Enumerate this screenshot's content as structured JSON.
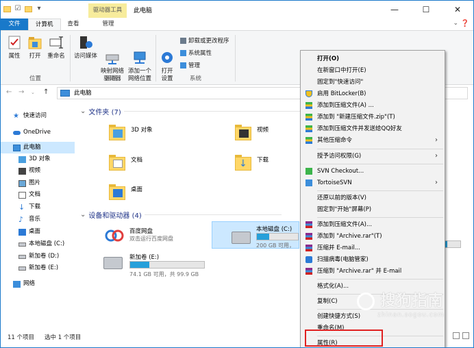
{
  "titlebar": {
    "context_band": "驱动器工具",
    "title": "此电脑",
    "minimize": "—",
    "maximize": "☐",
    "close": "✕"
  },
  "tabs": [
    {
      "label": "文件"
    },
    {
      "label": "计算机"
    },
    {
      "label": "查看"
    },
    {
      "label": "管理"
    }
  ],
  "ribbon": {
    "location": {
      "label": "位置",
      "buttons": [
        "属性",
        "打开",
        "重命名"
      ]
    },
    "network": {
      "label": "网络",
      "buttons": [
        "访问媒体",
        "映射网络\n驱动器",
        "添加一个\n网络位置"
      ]
    },
    "system": {
      "label": "系统",
      "open_settings": "打开\n设置",
      "items": [
        "卸载或更改程序",
        "系统属性",
        "管理"
      ]
    }
  },
  "address": {
    "path": "此电脑"
  },
  "sidebar": {
    "items": [
      {
        "label": "快速访问",
        "icon": "star-icon"
      },
      {
        "label": "OneDrive",
        "icon": "cloud-icon"
      },
      {
        "label": "此电脑",
        "icon": "computer-icon",
        "selected": true
      },
      {
        "label": "3D 对象",
        "icon": "cube-icon"
      },
      {
        "label": "视频",
        "icon": "video-icon"
      },
      {
        "label": "图片",
        "icon": "picture-icon"
      },
      {
        "label": "文档",
        "icon": "document-icon"
      },
      {
        "label": "下载",
        "icon": "download-icon"
      },
      {
        "label": "音乐",
        "icon": "music-icon"
      },
      {
        "label": "桌面",
        "icon": "desktop-icon"
      },
      {
        "label": "本地磁盘 (C:)",
        "icon": "drive-icon"
      },
      {
        "label": "新加卷 (D:)",
        "icon": "drive-icon"
      },
      {
        "label": "新加卷 (E:)",
        "icon": "drive-icon"
      },
      {
        "label": "网络",
        "icon": "network-icon"
      }
    ]
  },
  "folders_group": "文件夹 (7)",
  "folders": [
    {
      "label": "3D 对象"
    },
    {
      "label": "视频"
    },
    {
      "label": "文档"
    },
    {
      "label": "下载"
    },
    {
      "label": "桌面"
    }
  ],
  "drives_group": "设备和驱动器 (4)",
  "drives": {
    "baidu": {
      "label": "百度网盘",
      "sub": "双击运行百度网盘"
    },
    "c": {
      "label": "本地磁盘 (C:)",
      "used_fraction": 0.3,
      "text": "200 GB 可用，"
    },
    "e": {
      "label": "新加卷 (E:)",
      "used_fraction": 0.26,
      "text": "74.1 GB 可用，共 99.9 GB"
    }
  },
  "status": {
    "count": "11 个项目",
    "selected": "选中 1 个项目"
  },
  "context_menu": {
    "items": [
      {
        "label": "打开(O)",
        "bold": true
      },
      {
        "label": "在新窗口中打开(E)"
      },
      {
        "label": "固定到\"快速访问\""
      },
      {
        "label": "启用 BitLocker(B)",
        "icon": "shield-icon"
      },
      {
        "label": "添加到压缩文件(A) ...",
        "icon": "archive-icon"
      },
      {
        "label": "添加到 \"新建压缩文件.zip\"(T)",
        "icon": "archive-icon"
      },
      {
        "label": "添加到压缩文件并发送给QQ好友",
        "icon": "archive-icon"
      },
      {
        "label": "其他压缩命令",
        "icon": "archive-icon",
        "submenu": true
      },
      {
        "label": "授予访问权限(G)",
        "submenu": true
      },
      {
        "label": "SVN Checkout...",
        "icon": "svn-icon"
      },
      {
        "label": "TortoiseSVN",
        "icon": "svn-icon",
        "submenu": true
      },
      {
        "label": "还原以前的版本(V)"
      },
      {
        "label": "固定到\"开始\"屏幕(P)"
      },
      {
        "label": "添加到压缩文件(A)...",
        "icon": "winrar-icon"
      },
      {
        "label": "添加到 \"Archive.rar\"(T)",
        "icon": "winrar-icon"
      },
      {
        "label": "压缩并 E-mail...",
        "icon": "winrar-icon"
      },
      {
        "label": "扫描病毒(电脑管家)",
        "icon": "guard-icon"
      },
      {
        "label": "压缩到 \"Archive.rar\" 并 E-mail",
        "icon": "winrar-icon"
      },
      {
        "label": "格式化(A)..."
      },
      {
        "label": "复制(C)"
      },
      {
        "label": "创建快捷方式(S)"
      },
      {
        "label": "重命名(M)"
      },
      {
        "label": "属性(R)"
      }
    ]
  },
  "watermark": {
    "text": "搜狗指南",
    "sub": "zhinan.sogou.com"
  },
  "colors": {
    "accent": "#1979ca",
    "selection": "#cce8ff",
    "highlight_box": "#e02020"
  }
}
